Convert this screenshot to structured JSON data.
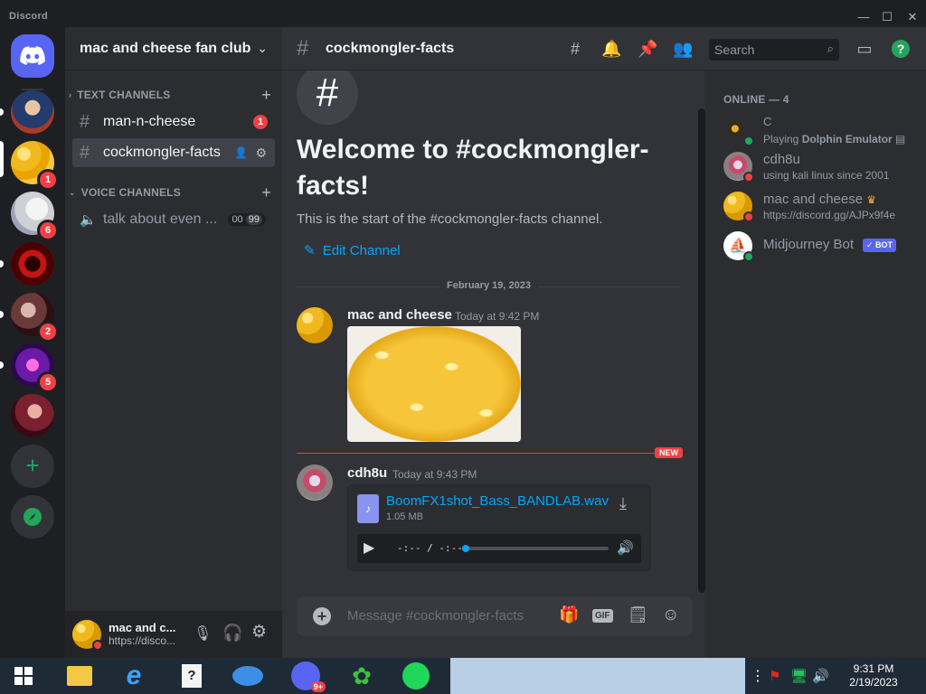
{
  "window": {
    "title": "Discord"
  },
  "servers": [
    {
      "name": "server-1",
      "badge": ""
    },
    {
      "name": "server-mac-and-cheese",
      "badge": "1"
    },
    {
      "name": "server-3",
      "badge": "6"
    },
    {
      "name": "server-4",
      "badge": ""
    },
    {
      "name": "server-5",
      "badge": "2"
    },
    {
      "name": "server-6",
      "badge": "5"
    },
    {
      "name": "server-7",
      "badge": ""
    }
  ],
  "sidebar": {
    "guild_name": "mac and cheese fan club",
    "text_category": "TEXT CHANNELS",
    "voice_category": "VOICE CHANNELS",
    "channels": [
      {
        "label": "man-n-cheese",
        "mention": "1"
      },
      {
        "label": "cockmongler-facts"
      }
    ],
    "voice_channel": {
      "label": "talk about even ...",
      "count_a": "00",
      "count_b": "99"
    }
  },
  "user_panel": {
    "name": "mac and c...",
    "status": "https://disco..."
  },
  "header": {
    "channel_name": "cockmongler-facts",
    "search_placeholder": "Search"
  },
  "chat": {
    "welcome_title": "Welcome to #cockmongler-facts!",
    "welcome_line1": "Welcome to #cockmongler-",
    "welcome_line2": "facts!",
    "welcome_sub": "This is the start of the #cockmongler-facts channel.",
    "edit_channel": "Edit Channel",
    "date_divider": "February 19, 2023",
    "new_label": "NEW",
    "messages": [
      {
        "author": "mac and cheese",
        "timestamp": "Today at 9:42 PM"
      },
      {
        "author": "cdh8u",
        "timestamp": "Today at 9:43 PM",
        "file_name": "BoomFX1shot_Bass_BANDLAB.wav",
        "file_size": "1.05 MB",
        "audio_time": "-:-- / -:--"
      }
    ],
    "composer_placeholder": "Message #cockmongler-facts"
  },
  "members": {
    "section": "ONLINE — 4",
    "list": [
      {
        "name": "C",
        "activity_prefix": "Playing ",
        "activity": "Dolphin Emulator",
        "status": "online"
      },
      {
        "name": "cdh8u",
        "activity_prefix": "",
        "activity": "using kali linux since 2001",
        "status": "dnd"
      },
      {
        "name": "mac and cheese",
        "activity_prefix": "",
        "activity": "https://discord.gg/AJPx9f4e",
        "status": "dnd"
      },
      {
        "name": "Midjourney Bot",
        "bot_tag": "✓ BOT",
        "status": "online"
      }
    ]
  },
  "taskbar": {
    "time": "9:31 PM",
    "date": "2/19/2023",
    "discord_badge": "9+"
  },
  "colors": {
    "accent": "#5865f2",
    "danger": "#f23f43",
    "online": "#23a55a",
    "link": "#00a8fc"
  }
}
